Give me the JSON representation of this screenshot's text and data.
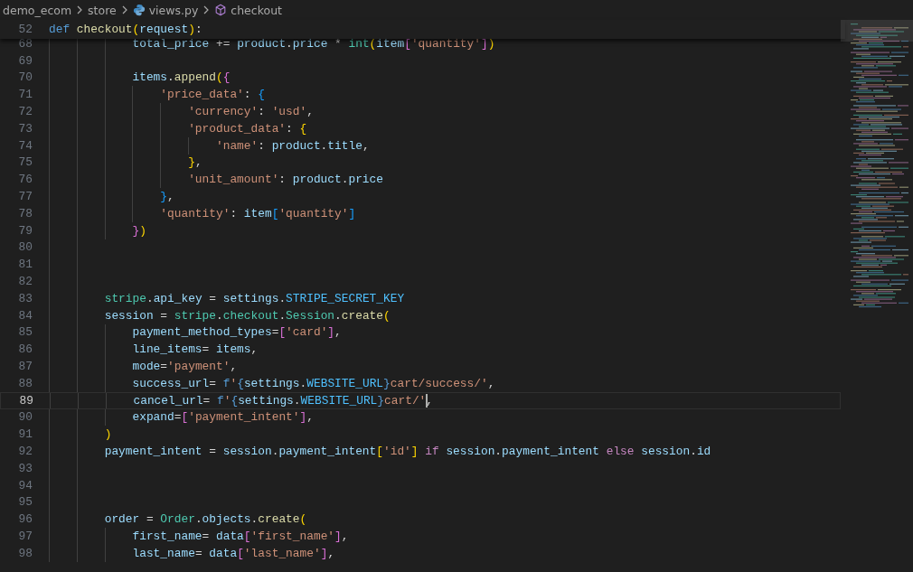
{
  "breadcrumbs": [
    {
      "kind": "folder",
      "text": "demo_ecom"
    },
    {
      "kind": "folder",
      "text": "store"
    },
    {
      "kind": "file",
      "text": "views.py"
    },
    {
      "kind": "symbol",
      "text": "checkout"
    }
  ],
  "sticky_line": {
    "number": "52",
    "tokens": [
      {
        "kind": "kw",
        "text": "def "
      },
      {
        "kind": "fn",
        "text": "checkout"
      },
      {
        "kind": "b1",
        "text": "("
      },
      {
        "kind": "var",
        "text": "request"
      },
      {
        "kind": "b1",
        "text": ")"
      },
      {
        "kind": "op",
        "text": ":"
      }
    ]
  },
  "lines": [
    {
      "number": "68",
      "current": false,
      "tokens": [
        {
          "kind": "var",
          "text": "            total_price"
        },
        {
          "kind": "op",
          "text": " += "
        },
        {
          "kind": "var",
          "text": "product"
        },
        {
          "kind": "op",
          "text": "."
        },
        {
          "kind": "var",
          "text": "price"
        },
        {
          "kind": "op",
          "text": " * "
        },
        {
          "kind": "cls",
          "text": "int"
        },
        {
          "kind": "b1",
          "text": "("
        },
        {
          "kind": "var",
          "text": "item"
        },
        {
          "kind": "b2",
          "text": "["
        },
        {
          "kind": "str",
          "text": "'quantity'"
        },
        {
          "kind": "b2",
          "text": "]"
        },
        {
          "kind": "b1",
          "text": ")"
        }
      ]
    },
    {
      "number": "69",
      "current": false
    },
    {
      "number": "70",
      "current": false,
      "tokens": [
        {
          "kind": "var",
          "text": "            items"
        },
        {
          "kind": "op",
          "text": "."
        },
        {
          "kind": "fn",
          "text": "append"
        },
        {
          "kind": "b1",
          "text": "("
        },
        {
          "kind": "b2",
          "text": "{"
        }
      ]
    },
    {
      "number": "71",
      "current": false,
      "tokens": [
        {
          "kind": "str",
          "text": "                'price_data'"
        },
        {
          "kind": "op",
          "text": ": "
        },
        {
          "kind": "b3",
          "text": "{"
        }
      ]
    },
    {
      "number": "72",
      "current": false,
      "tokens": [
        {
          "kind": "str",
          "text": "                    'currency'"
        },
        {
          "kind": "op",
          "text": ": "
        },
        {
          "kind": "str",
          "text": "'usd'"
        },
        {
          "kind": "op",
          "text": ","
        }
      ]
    },
    {
      "number": "73",
      "current": false,
      "tokens": [
        {
          "kind": "str",
          "text": "                    'product_data'"
        },
        {
          "kind": "op",
          "text": ": "
        },
        {
          "kind": "b1",
          "text": "{"
        }
      ]
    },
    {
      "number": "74",
      "current": false,
      "tokens": [
        {
          "kind": "str",
          "text": "                        'name'"
        },
        {
          "kind": "op",
          "text": ": "
        },
        {
          "kind": "var",
          "text": "product"
        },
        {
          "kind": "op",
          "text": "."
        },
        {
          "kind": "var",
          "text": "title"
        },
        {
          "kind": "op",
          "text": ","
        }
      ]
    },
    {
      "number": "75",
      "current": false,
      "tokens": [
        {
          "kind": "b1",
          "text": "                    }"
        },
        {
          "kind": "op",
          "text": ","
        }
      ]
    },
    {
      "number": "76",
      "current": false,
      "tokens": [
        {
          "kind": "str",
          "text": "                    'unit_amount'"
        },
        {
          "kind": "op",
          "text": ": "
        },
        {
          "kind": "var",
          "text": "product"
        },
        {
          "kind": "op",
          "text": "."
        },
        {
          "kind": "var",
          "text": "price"
        }
      ]
    },
    {
      "number": "77",
      "current": false,
      "tokens": [
        {
          "kind": "b3",
          "text": "                }"
        },
        {
          "kind": "op",
          "text": ","
        }
      ]
    },
    {
      "number": "78",
      "current": false,
      "tokens": [
        {
          "kind": "str",
          "text": "                'quantity'"
        },
        {
          "kind": "op",
          "text": ": "
        },
        {
          "kind": "var",
          "text": "item"
        },
        {
          "kind": "b3",
          "text": "["
        },
        {
          "kind": "str",
          "text": "'quantity'"
        },
        {
          "kind": "b3",
          "text": "]"
        }
      ]
    },
    {
      "number": "79",
      "current": false,
      "tokens": [
        {
          "kind": "b2",
          "text": "            }"
        },
        {
          "kind": "b1",
          "text": ")"
        }
      ]
    },
    {
      "number": "80",
      "current": false
    },
    {
      "number": "81",
      "current": false
    },
    {
      "number": "82",
      "current": false
    },
    {
      "number": "83",
      "current": false,
      "tokens": [
        {
          "kind": "cls",
          "text": "        stripe"
        },
        {
          "kind": "op",
          "text": "."
        },
        {
          "kind": "var",
          "text": "api_key"
        },
        {
          "kind": "op",
          "text": " = "
        },
        {
          "kind": "var",
          "text": "settings"
        },
        {
          "kind": "op",
          "text": "."
        },
        {
          "kind": "const",
          "text": "STRIPE_SECRET_KEY"
        }
      ]
    },
    {
      "number": "84",
      "current": false,
      "tokens": [
        {
          "kind": "var",
          "text": "        session"
        },
        {
          "kind": "op",
          "text": " = "
        },
        {
          "kind": "cls",
          "text": "stripe"
        },
        {
          "kind": "op",
          "text": "."
        },
        {
          "kind": "cls",
          "text": "checkout"
        },
        {
          "kind": "op",
          "text": "."
        },
        {
          "kind": "cls",
          "text": "Session"
        },
        {
          "kind": "op",
          "text": "."
        },
        {
          "kind": "fn",
          "text": "create"
        },
        {
          "kind": "b1",
          "text": "("
        }
      ]
    },
    {
      "number": "85",
      "current": false,
      "tokens": [
        {
          "kind": "var",
          "text": "            payment_method_types"
        },
        {
          "kind": "op",
          "text": "="
        },
        {
          "kind": "b2",
          "text": "["
        },
        {
          "kind": "str",
          "text": "'card'"
        },
        {
          "kind": "b2",
          "text": "]"
        },
        {
          "kind": "op",
          "text": ","
        }
      ]
    },
    {
      "number": "86",
      "current": false,
      "tokens": [
        {
          "kind": "var",
          "text": "            line_items"
        },
        {
          "kind": "op",
          "text": "= "
        },
        {
          "kind": "var",
          "text": "items"
        },
        {
          "kind": "op",
          "text": ","
        }
      ]
    },
    {
      "number": "87",
      "current": false,
      "tokens": [
        {
          "kind": "var",
          "text": "            mode"
        },
        {
          "kind": "op",
          "text": "="
        },
        {
          "kind": "str",
          "text": "'payment'"
        },
        {
          "kind": "op",
          "text": ","
        }
      ]
    },
    {
      "number": "88",
      "current": false,
      "tokens": [
        {
          "kind": "var",
          "text": "            success_url"
        },
        {
          "kind": "op",
          "text": "= "
        },
        {
          "kind": "kw",
          "text": "f"
        },
        {
          "kind": "str",
          "text": "'"
        },
        {
          "kind": "kw",
          "text": "{"
        },
        {
          "kind": "var",
          "text": "settings"
        },
        {
          "kind": "op",
          "text": "."
        },
        {
          "kind": "const",
          "text": "WEBSITE_URL"
        },
        {
          "kind": "kw",
          "text": "}"
        },
        {
          "kind": "str",
          "text": "cart/success/'"
        },
        {
          "kind": "op",
          "text": ","
        }
      ]
    },
    {
      "number": "89",
      "current": true,
      "tokens": [
        {
          "kind": "var",
          "text": "            cancel_url"
        },
        {
          "kind": "op",
          "text": "= "
        },
        {
          "kind": "kw",
          "text": "f"
        },
        {
          "kind": "str",
          "text": "'"
        },
        {
          "kind": "kw",
          "text": "{"
        },
        {
          "kind": "var",
          "text": "settings"
        },
        {
          "kind": "op",
          "text": "."
        },
        {
          "kind": "const",
          "text": "WEBSITE_URL"
        },
        {
          "kind": "kw",
          "text": "}"
        },
        {
          "kind": "str",
          "text": "cart/'",
          "caret": true
        },
        {
          "kind": "op",
          "text": ","
        }
      ]
    },
    {
      "number": "90",
      "current": false,
      "tokens": [
        {
          "kind": "var",
          "text": "            expand"
        },
        {
          "kind": "op",
          "text": "="
        },
        {
          "kind": "b2",
          "text": "["
        },
        {
          "kind": "str",
          "text": "'payment_intent'"
        },
        {
          "kind": "b2",
          "text": "]"
        },
        {
          "kind": "op",
          "text": ","
        }
      ]
    },
    {
      "number": "91",
      "current": false,
      "tokens": [
        {
          "kind": "b1",
          "text": "        )"
        }
      ]
    },
    {
      "number": "92",
      "current": false,
      "tokens": [
        {
          "kind": "var",
          "text": "        payment_intent"
        },
        {
          "kind": "op",
          "text": " = "
        },
        {
          "kind": "var",
          "text": "session"
        },
        {
          "kind": "op",
          "text": "."
        },
        {
          "kind": "var",
          "text": "payment_intent"
        },
        {
          "kind": "b1",
          "text": "["
        },
        {
          "kind": "str",
          "text": "'id'"
        },
        {
          "kind": "b1",
          "text": "] "
        },
        {
          "kind": "ctl",
          "text": "if "
        },
        {
          "kind": "var",
          "text": "session"
        },
        {
          "kind": "op",
          "text": "."
        },
        {
          "kind": "var",
          "text": "payment_intent "
        },
        {
          "kind": "ctl",
          "text": "else "
        },
        {
          "kind": "var",
          "text": "session"
        },
        {
          "kind": "op",
          "text": "."
        },
        {
          "kind": "var",
          "text": "id"
        }
      ]
    },
    {
      "number": "93",
      "current": false
    },
    {
      "number": "94",
      "current": false
    },
    {
      "number": "95",
      "current": false
    },
    {
      "number": "96",
      "current": false,
      "tokens": [
        {
          "kind": "var",
          "text": "        order"
        },
        {
          "kind": "op",
          "text": " = "
        },
        {
          "kind": "cls",
          "text": "Order"
        },
        {
          "kind": "op",
          "text": "."
        },
        {
          "kind": "var",
          "text": "objects"
        },
        {
          "kind": "op",
          "text": "."
        },
        {
          "kind": "fn",
          "text": "create"
        },
        {
          "kind": "b1",
          "text": "("
        }
      ]
    },
    {
      "number": "97",
      "current": false,
      "tokens": [
        {
          "kind": "var",
          "text": "            first_name"
        },
        {
          "kind": "op",
          "text": "= "
        },
        {
          "kind": "var",
          "text": "data"
        },
        {
          "kind": "b2",
          "text": "["
        },
        {
          "kind": "str",
          "text": "'first_name'"
        },
        {
          "kind": "b2",
          "text": "]"
        },
        {
          "kind": "op",
          "text": ","
        }
      ]
    },
    {
      "number": "98",
      "current": false,
      "tokens": [
        {
          "kind": "var",
          "text": "            last_name"
        },
        {
          "kind": "op",
          "text": "= "
        },
        {
          "kind": "var",
          "text": "data"
        },
        {
          "kind": "b2",
          "text": "["
        },
        {
          "kind": "str",
          "text": "'last_name'"
        },
        {
          "kind": "b2",
          "text": "]"
        },
        {
          "kind": "op",
          "text": ","
        }
      ]
    }
  ]
}
